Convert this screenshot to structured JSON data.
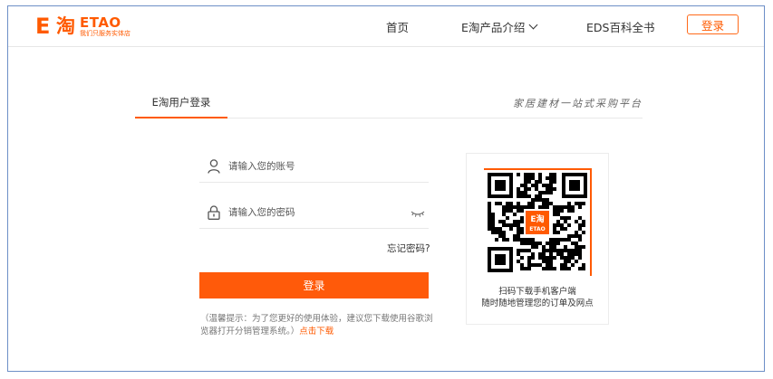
{
  "header": {
    "logo_brand": "ETAO",
    "logo_mark_e": "E",
    "logo_mark_tao": "淘",
    "logo_slogan": "我们只服务实体店",
    "nav": {
      "home": "首页",
      "products": "E淘产品介绍",
      "eds": "EDS百科全书"
    },
    "login_button": "登录"
  },
  "login": {
    "tab_label": "E淘用户登录",
    "tagline": "家居建材一站式采购平台",
    "account_placeholder": "请输入您的账号",
    "password_placeholder": "请输入您的密码",
    "forgot_label": "忘记密码?",
    "submit_label": "登录",
    "hint_text": "（温馨提示：为了您更好的使用体验，建议您下载使用谷歌浏览器打开分销管理系统。）",
    "hint_link": "点击下载"
  },
  "qr": {
    "caption_line1": "扫码下载手机客户端",
    "caption_line2": "随时随地管理您的订单及网点",
    "center_logo_top": "E淘",
    "center_logo_bottom": "ETAO"
  },
  "colors": {
    "accent": "#ff5a00",
    "frame_border": "#6d8fc7"
  }
}
